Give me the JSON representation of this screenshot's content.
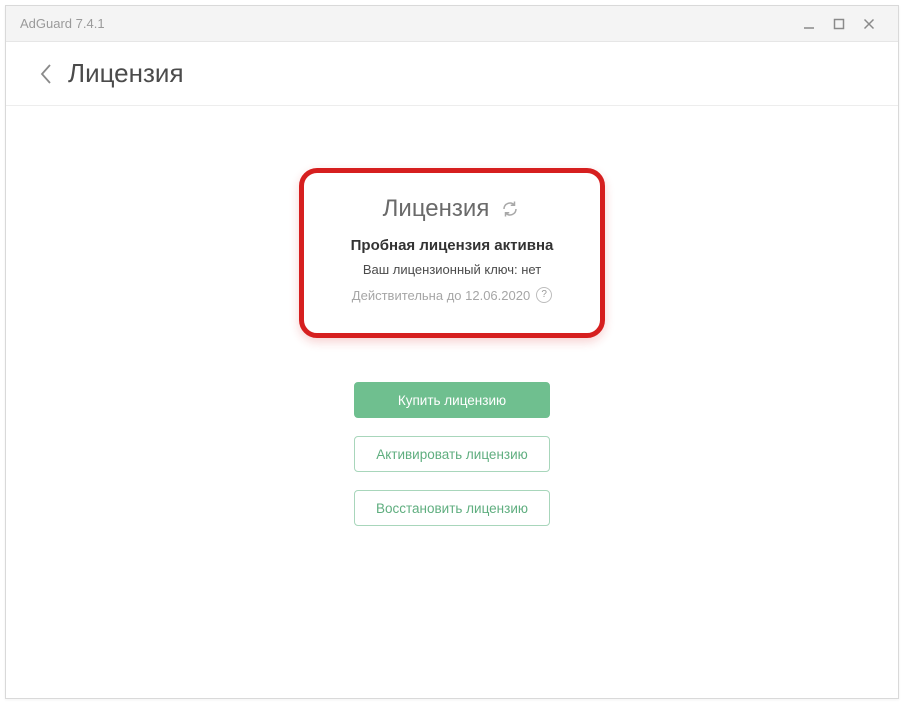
{
  "window": {
    "title": "AdGuard 7.4.1"
  },
  "header": {
    "page_title": "Лицензия"
  },
  "card": {
    "title": "Лицензия",
    "status": "Пробная лицензия активна",
    "key_label": "Ваш лицензионный ключ: нет",
    "valid_until": "Действительна до 12.06.2020",
    "help_glyph": "?"
  },
  "actions": {
    "buy": "Купить лицензию",
    "activate": "Активировать лицензию",
    "restore": "Восстановить лицензию"
  }
}
